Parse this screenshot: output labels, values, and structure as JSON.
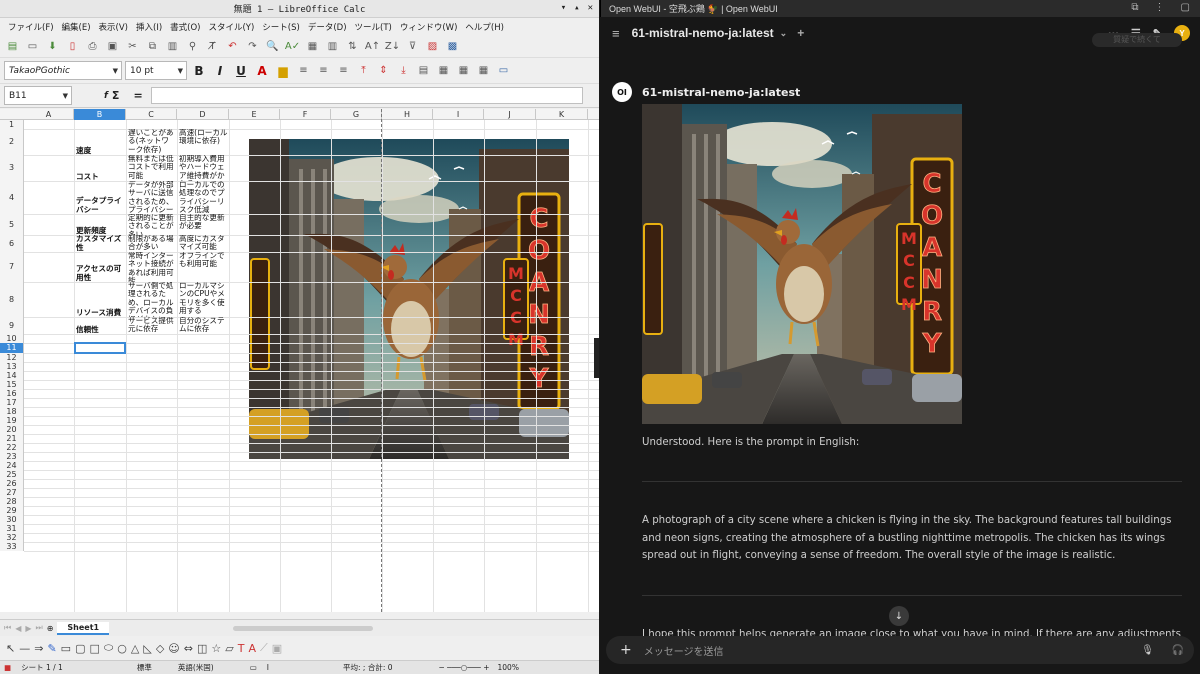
{
  "lo": {
    "title": "無題 1 — LibreOffice Calc",
    "menu": [
      "ファイル(F)",
      "編集(E)",
      "表示(V)",
      "挿入(I)",
      "書式(O)",
      "スタイル(Y)",
      "シート(S)",
      "データ(D)",
      "ツール(T)",
      "ウィンドウ(W)",
      "ヘルプ(H)"
    ],
    "font_name": "TakaoPGothic",
    "font_size": "10 pt",
    "name_box": "B11",
    "fx": "f",
    "sigma": "Σ",
    "equals": "=",
    "columns": [
      "A",
      "B",
      "C",
      "D",
      "E",
      "F",
      "G",
      "H",
      "I",
      "J",
      "K"
    ],
    "selected_column": "B",
    "rows": [
      "1",
      "2",
      "3",
      "4",
      "5",
      "6",
      "7",
      "8",
      "9",
      "10",
      "11",
      "12",
      "13",
      "14",
      "15",
      "16",
      "17",
      "18",
      "19",
      "20",
      "21",
      "22",
      "23",
      "24",
      "25",
      "26",
      "27",
      "28",
      "29",
      "30",
      "31",
      "32",
      "33"
    ],
    "selected_row": "11",
    "table": [
      {
        "b": "速度",
        "c": "遅いことがある(ネットワーク依存)",
        "d": "高速(ローカル環境に依存)"
      },
      {
        "b": "コスト",
        "c": "無料または低コストで利用可能",
        "d": "初期導入費用やハードウェア維持費がかかる"
      },
      {
        "b": "データプライバシー",
        "c": "データが外部サーバに送信されるため、プライバシーリスクあり",
        "d": "ローカルでの処理なのでプライバシーリスク低減"
      },
      {
        "b": "更新頻度",
        "c": "定期的に更新されることが多い",
        "d": "自主的な更新が必要"
      },
      {
        "b": "カスタマイズ性",
        "c": "制限がある場合が多い",
        "d": "高度にカスタマイズ可能"
      },
      {
        "b": "アクセスの可用性",
        "c": "常時インターネット接続があれば利用可能",
        "d": "オフラインでも利用可能"
      },
      {
        "b": "リソース消費",
        "c": "サーバ側で処理されるため、ローカルデバイスの負担が少ない",
        "d": "ローカルマシンのCPUやメモリを多く使用する"
      },
      {
        "b": "信頼性",
        "c": "サービス提供元に依存",
        "d": "自分のシステムに依存"
      }
    ],
    "sheet_tab": "Sheet1",
    "status": {
      "sheet": "シート 1 / 1",
      "style": "標準",
      "lang": "英語(米国)",
      "sum": "平均: ; 合計: 0",
      "zoom": "100%"
    }
  },
  "ow": {
    "window_title": "Open WebUI - 空飛ぶ鶏 🐓 | Open WebUI",
    "model": "61-mistral-nemo-ja:latest",
    "ghost_label": "質疑で続くて",
    "avatar_text": "OI",
    "user_initial": "Y",
    "msg1": "Understood. Here is the prompt in English:",
    "msg2": "A photograph of a city scene where a chicken is flying in the sky. The background features tall buildings and neon signs, creating the atmosphere of a bustling nighttime metropolis. The chicken has its wings spread out in flight, conveying a sense of freedom. The overall style of the image is realistic.",
    "msg3": "I hope this prompt helps generate an image close to what you have in mind. If there are any adjustments or",
    "input_placeholder": "メッセージを送信",
    "sign_letters": "COANRY",
    "sign2_letters": "MCCM",
    "colors": {
      "bg": "#171717",
      "accent": "#e8b010",
      "neon": "#d8342b"
    }
  }
}
